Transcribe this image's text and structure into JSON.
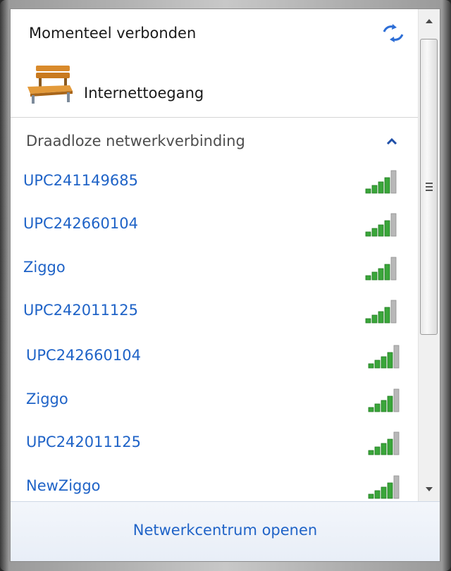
{
  "header": {
    "title": "Momenteel verbonden",
    "refresh_icon": "refresh-arrows-icon"
  },
  "current_connection": {
    "icon": "bench-icon",
    "label": "Internettoegang"
  },
  "section": {
    "title": "Draadloze netwerkverbinding",
    "toggle_icon": "chevron-up-icon"
  },
  "networks": [
    {
      "name": "UPC241149685",
      "signal_bars": 4
    },
    {
      "name": "UPC242660104",
      "signal_bars": 4
    },
    {
      "name": "Ziggo",
      "signal_bars": 4
    },
    {
      "name": "UPC242011125",
      "signal_bars": 4
    },
    {
      "name": "UPC242660104",
      "signal_bars": 4
    },
    {
      "name": "Ziggo",
      "signal_bars": 4
    },
    {
      "name": "UPC242011125",
      "signal_bars": 4
    },
    {
      "name": "NewZiggo",
      "signal_bars": 4
    }
  ],
  "footer": {
    "link_label": "Netwerkcentrum openen"
  },
  "colors": {
    "link": "#1f63c7",
    "signal_green": "#3aa63a",
    "signal_gray": "#b8b8b8"
  }
}
